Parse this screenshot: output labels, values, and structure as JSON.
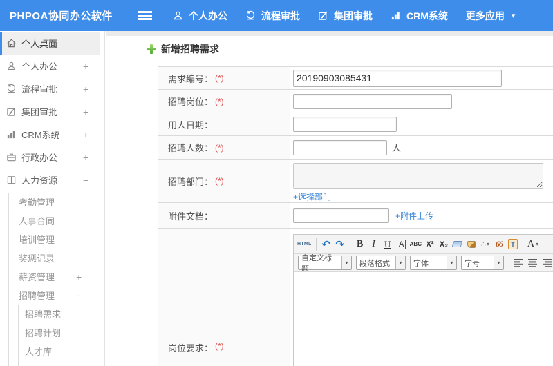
{
  "topbar": {
    "logo": "PHPOA协同办公软件",
    "nav": [
      {
        "label": "个人办公"
      },
      {
        "label": "流程审批"
      },
      {
        "label": "集团审批"
      },
      {
        "label": "CRM系统"
      },
      {
        "label": "更多应用"
      }
    ]
  },
  "icons": {
    "caret_down": "▾",
    "undo": "↶",
    "redo": "↷",
    "dots": "∴"
  },
  "sidebar": {
    "items": [
      {
        "label": "个人桌面",
        "expander": ""
      },
      {
        "label": "个人办公",
        "expander": "+"
      },
      {
        "label": "流程审批",
        "expander": "+"
      },
      {
        "label": "集团审批",
        "expander": "+"
      },
      {
        "label": "CRM系统",
        "expander": "+"
      },
      {
        "label": "行政办公",
        "expander": "+"
      },
      {
        "label": "人力资源",
        "expander": "−"
      }
    ],
    "hr_children": [
      {
        "label": "考勤管理",
        "expander": ""
      },
      {
        "label": "人事合同",
        "expander": ""
      },
      {
        "label": "培训管理",
        "expander": ""
      },
      {
        "label": "奖惩记录",
        "expander": ""
      },
      {
        "label": "薪资管理",
        "expander": "+"
      },
      {
        "label": "招聘管理",
        "expander": "−"
      }
    ],
    "recruit_children": [
      {
        "label": "招聘需求"
      },
      {
        "label": "招聘计划"
      },
      {
        "label": "人才库"
      }
    ]
  },
  "page": {
    "title": "新增招聘需求"
  },
  "form": {
    "req_no": {
      "label": "需求编号：",
      "required": "(*)",
      "value": "20190903085431"
    },
    "position": {
      "label": "招聘岗位：",
      "required": "(*)"
    },
    "date": {
      "label": "用人日期："
    },
    "count": {
      "label": "招聘人数：",
      "required": "(*)",
      "suffix": "人"
    },
    "dept": {
      "label": "招聘部门：",
      "required": "(*)",
      "link": "+选择部门"
    },
    "attachment": {
      "label": "附件文档：",
      "link": "+附件上传"
    },
    "requirement": {
      "label": "岗位要求：",
      "required": "(*)"
    }
  },
  "editor": {
    "toolbar1": {
      "html": "HTML",
      "bold": "B",
      "italic": "I",
      "underline": "U",
      "fontbox": "A",
      "strike": "ABC",
      "sup": "X²",
      "sub": "X₂",
      "quote": "66",
      "paste": "T",
      "color": "A"
    },
    "toolbar2": {
      "custom_title": "自定义标题",
      "paragraph": "段落格式",
      "font": "字体",
      "size": "字号"
    }
  },
  "colors": {
    "topbar_blue": "#3f8dea",
    "link_blue": "#3a87d8",
    "required_red": "#e14848",
    "title_plus_green": "#56ad35"
  }
}
